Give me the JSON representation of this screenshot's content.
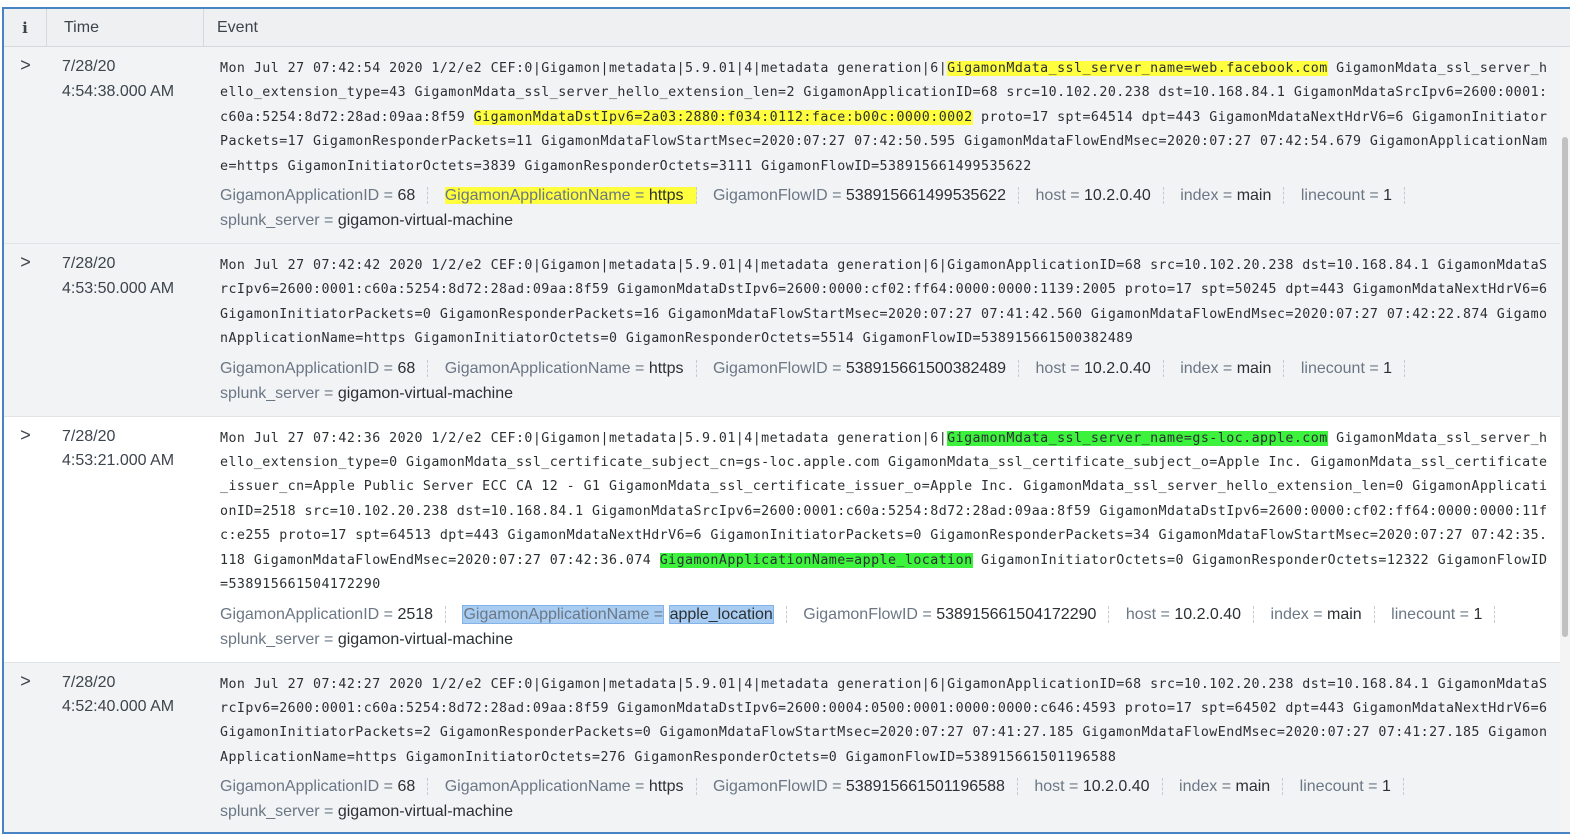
{
  "header": {
    "info_label": "i",
    "time_label": "Time",
    "event_label": "Event"
  },
  "rows": [
    {
      "time_date": "7/28/20",
      "time_clock": "4:54:38.000 AM",
      "raw": [
        {
          "t": "Mon Jul 27 07:42:54 2020 1/2/e2 CEF:0|Gigamon|metadata|5.9.01|4|metadata generation|6|",
          "h": ""
        },
        {
          "t": "GigamonMdata_ssl_server_name=web.facebook.com",
          "h": "y"
        },
        {
          "t": " GigamonMdata_ssl_server_hello_extension_type=43 GigamonMdata_ssl_server_hello_extension_len=2 GigamonApplicationID=68 src=10.102.20.238 dst=10.168.84.1 GigamonMdataSrcIpv6=2600:0001:c60a:5254:8d72:28ad:09aa:8f59 ",
          "h": ""
        },
        {
          "t": "GigamonMdataDstIpv6=2a03:2880:f034:0112:face:b00c:0000:0002",
          "h": "y"
        },
        {
          "t": " proto=17 spt=64514 dpt=443 GigamonMdataNextHdrV6=6 GigamonInitiatorPackets=17 GigamonResponderPackets=11 GigamonMdataFlowStartMsec=2020:07:27 07:42:50.595 GigamonMdataFlowEndMsec=2020:07:27 07:42:54.679 GigamonApplicationName=https GigamonInitiatorOctets=3839 GigamonResponderOctets=3111 GigamonFlowID=538915661499535622",
          "h": ""
        }
      ],
      "fields": [
        {
          "k": "GigamonApplicationID =",
          "v": "68",
          "h": ""
        },
        {
          "k": "GigamonApplicationName =",
          "v": "https",
          "h": "y"
        },
        {
          "k": "GigamonFlowID =",
          "v": "538915661499535622",
          "h": ""
        },
        {
          "k": "host =",
          "v": "10.2.0.40",
          "h": ""
        },
        {
          "k": "index =",
          "v": "main",
          "h": ""
        },
        {
          "k": "linecount =",
          "v": "1",
          "h": ""
        },
        {
          "k": "splunk_server =",
          "v": "gigamon-virtual-machine",
          "h": ""
        }
      ]
    },
    {
      "time_date": "7/28/20",
      "time_clock": "4:53:50.000 AM",
      "raw": [
        {
          "t": "Mon Jul 27 07:42:42 2020 1/2/e2 CEF:0|Gigamon|metadata|5.9.01|4|metadata generation|6|GigamonApplicationID=68 src=10.102.20.238 dst=10.168.84.1 GigamonMdataSrcIpv6=2600:0001:c60a:5254:8d72:28ad:09aa:8f59 GigamonMdataDstIpv6=2600:0000:cf02:ff64:0000:0000:1139:2005 proto=17 spt=50245 dpt=443 GigamonMdataNextHdrV6=6 GigamonInitiatorPackets=0 GigamonResponderPackets=16 GigamonMdataFlowStartMsec=2020:07:27 07:41:42.560 GigamonMdataFlowEndMsec=2020:07:27 07:42:22.874 GigamonApplicationName=https GigamonInitiatorOctets=0 GigamonResponderOctets=5514 GigamonFlowID=538915661500382489",
          "h": ""
        }
      ],
      "fields": [
        {
          "k": "GigamonApplicationID =",
          "v": "68",
          "h": ""
        },
        {
          "k": "GigamonApplicationName =",
          "v": "https",
          "h": ""
        },
        {
          "k": "GigamonFlowID =",
          "v": "538915661500382489",
          "h": ""
        },
        {
          "k": "host =",
          "v": "10.2.0.40",
          "h": ""
        },
        {
          "k": "index =",
          "v": "main",
          "h": ""
        },
        {
          "k": "linecount =",
          "v": "1",
          "h": ""
        },
        {
          "k": "splunk_server =",
          "v": "gigamon-virtual-machine",
          "h": ""
        }
      ]
    },
    {
      "time_date": "7/28/20",
      "time_clock": "4:53:21.000 AM",
      "raw": [
        {
          "t": "Mon Jul 27 07:42:36 2020 1/2/e2 CEF:0|Gigamon|metadata|5.9.01|4|metadata generation|6|",
          "h": ""
        },
        {
          "t": "GigamonMdata_ssl_server_name=gs-loc.apple.com",
          "h": "g"
        },
        {
          "t": " GigamonMdata_ssl_server_hello_extension_type=0 GigamonMdata_ssl_certificate_subject_cn=gs-loc.apple.com GigamonMdata_ssl_certificate_subject_o=Apple Inc. GigamonMdata_ssl_certificate_issuer_cn=Apple Public Server ECC CA 12 - G1 GigamonMdata_ssl_certificate_issuer_o=Apple Inc. GigamonMdata_ssl_server_hello_extension_len=0 GigamonApplicationID=2518 src=10.102.20.238 dst=10.168.84.1 GigamonMdataSrcIpv6=2600:0001:c60a:5254:8d72:28ad:09aa:8f59 GigamonMdataDstIpv6=2600:0000:cf02:ff64:0000:0000:11fc:e255 proto=17 spt=64513 dpt=443 GigamonMdataNextHdrV6=6 GigamonInitiatorPackets=0 GigamonResponderPackets=34 GigamonMdataFlowStartMsec=2020:07:27 07:42:35.118 GigamonMdataFlowEndMsec=2020:07:27 07:42:36.074 ",
          "h": ""
        },
        {
          "t": "GigamonApplicationName=apple_location",
          "h": "g"
        },
        {
          "t": " GigamonInitiatorOctets=0 GigamonResponderOctets=12322 GigamonFlowID=538915661504172290",
          "h": ""
        }
      ],
      "fields": [
        {
          "k": "GigamonApplicationID =",
          "v": "2518",
          "h": ""
        },
        {
          "k": "GigamonApplicationName =",
          "v": "apple_location",
          "h": "sel"
        },
        {
          "k": "GigamonFlowID =",
          "v": "538915661504172290",
          "h": ""
        },
        {
          "k": "host =",
          "v": "10.2.0.40",
          "h": ""
        },
        {
          "k": "index =",
          "v": "main",
          "h": ""
        },
        {
          "k": "linecount =",
          "v": "1",
          "h": ""
        },
        {
          "k": "splunk_server =",
          "v": "gigamon-virtual-machine",
          "h": ""
        }
      ]
    },
    {
      "time_date": "7/28/20",
      "time_clock": "4:52:40.000 AM",
      "raw": [
        {
          "t": "Mon Jul 27 07:42:27 2020 1/2/e2 CEF:0|Gigamon|metadata|5.9.01|4|metadata generation|6|GigamonApplicationID=68 src=10.102.20.238 dst=10.168.84.1 GigamonMdataSrcIpv6=2600:0001:c60a:5254:8d72:28ad:09aa:8f59 GigamonMdataDstIpv6=2600:0004:0500:0001:0000:0000:c646:4593 proto=17 spt=64502 dpt=443 GigamonMdataNextHdrV6=6 GigamonInitiatorPackets=2 GigamonResponderPackets=0 GigamonMdataFlowStartMsec=2020:07:27 07:41:27.185 GigamonMdataFlowEndMsec=2020:07:27 07:41:27.185 GigamonApplicationName=https GigamonInitiatorOctets=276 GigamonResponderOctets=0 GigamonFlowID=538915661501196588",
          "h": ""
        }
      ],
      "fields": [
        {
          "k": "GigamonApplicationID =",
          "v": "68",
          "h": ""
        },
        {
          "k": "GigamonApplicationName =",
          "v": "https",
          "h": ""
        },
        {
          "k": "GigamonFlowID =",
          "v": "538915661501196588",
          "h": ""
        },
        {
          "k": "host =",
          "v": "10.2.0.40",
          "h": ""
        },
        {
          "k": "index =",
          "v": "main",
          "h": ""
        },
        {
          "k": "linecount =",
          "v": "1",
          "h": ""
        },
        {
          "k": "splunk_server =",
          "v": "gigamon-virtual-machine",
          "h": ""
        }
      ]
    }
  ],
  "icons": {
    "expand": "chevron-right-icon",
    "expand_glyph": ">"
  },
  "colors": {
    "highlight_yellow": "#ffff3d",
    "highlight_green": "#3cf23c",
    "selected_blue": "#a9cdf2",
    "frame_border": "#4a83c4"
  }
}
